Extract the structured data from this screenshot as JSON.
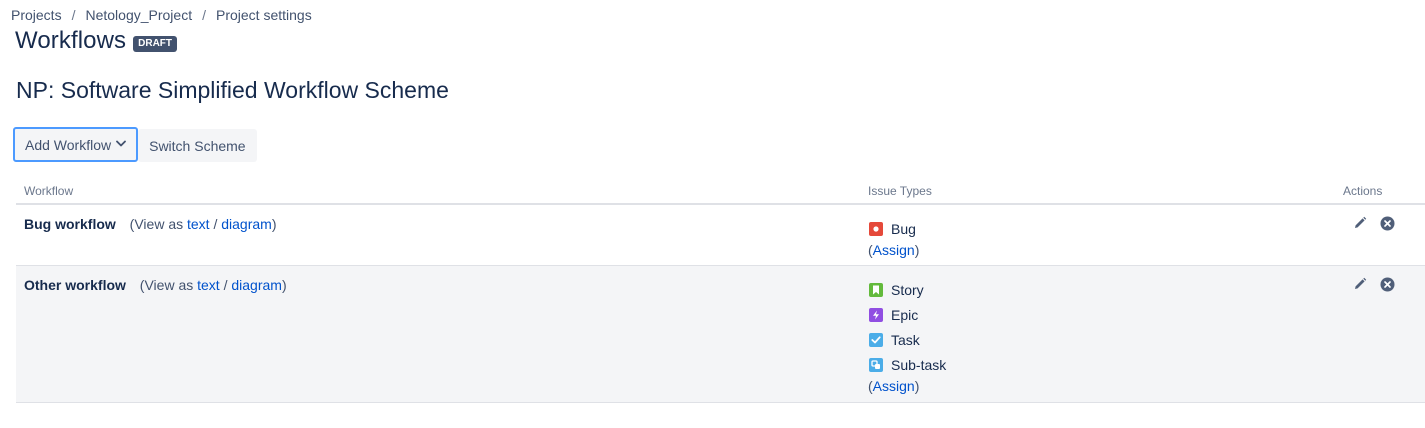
{
  "breadcrumb": {
    "items": [
      "Projects",
      "Netology_Project",
      "Project settings"
    ],
    "separator": "/"
  },
  "header": {
    "title": "Workflows",
    "status_lozenge": "DRAFT"
  },
  "scheme": {
    "name": "NP: Software Simplified Workflow Scheme"
  },
  "toolbar": {
    "add_workflow_label": "Add Workflow",
    "switch_scheme_label": "Switch Scheme"
  },
  "table": {
    "columns": [
      "Workflow",
      "Issue Types",
      "Actions"
    ],
    "rows": [
      {
        "workflow": "Bug workflow",
        "view_prefix": "(View as",
        "view_text": "text",
        "view_sep": "/",
        "view_diagram": "diagram",
        "view_suffix": ")",
        "issue_types": [
          {
            "label": "Bug",
            "icon": "bug-icon",
            "color": "#e5493a"
          }
        ],
        "assign_open": "(",
        "assign_label": "Assign",
        "assign_close": ")"
      },
      {
        "workflow": "Other workflow",
        "view_prefix": "(View as",
        "view_text": "text",
        "view_sep": "/",
        "view_diagram": "diagram",
        "view_suffix": ")",
        "issue_types": [
          {
            "label": "Story",
            "icon": "story-icon",
            "color": "#63ba3c"
          },
          {
            "label": "Epic",
            "icon": "epic-icon",
            "color": "#904ee2"
          },
          {
            "label": "Task",
            "icon": "task-icon",
            "color": "#4bade8"
          },
          {
            "label": "Sub-task",
            "icon": "subtask-icon",
            "color": "#4bade8"
          }
        ],
        "assign_open": "(",
        "assign_label": "Assign",
        "assign_close": ")"
      }
    ]
  },
  "colors": {
    "link": "#0052cc",
    "lozenge_bg": "#42526e",
    "focus_ring": "#4c9aff",
    "row_alt_bg": "#f4f5f7"
  }
}
